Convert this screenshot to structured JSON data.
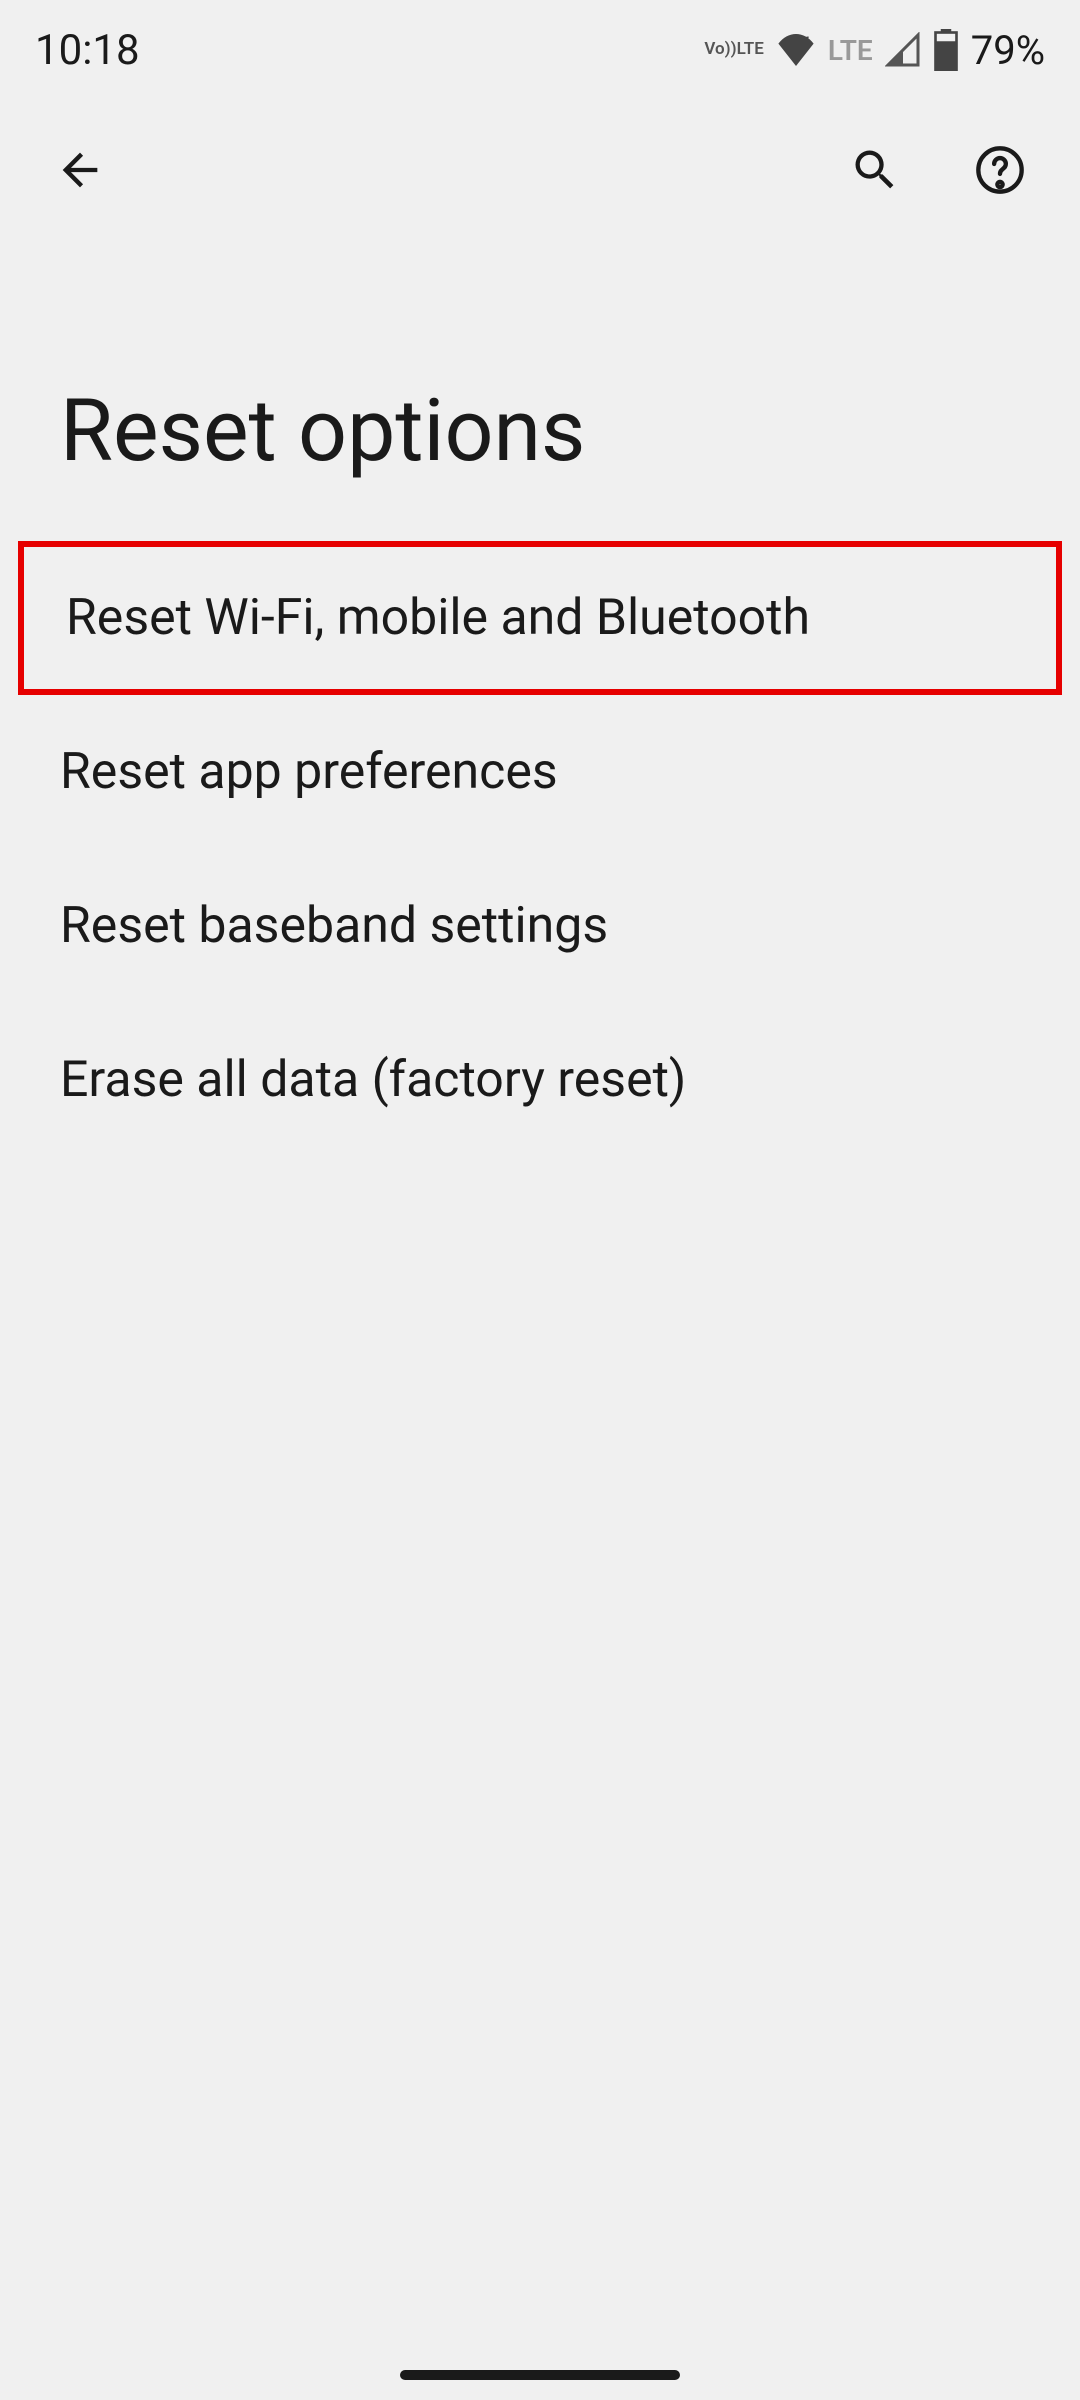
{
  "statusBar": {
    "time": "10:18",
    "volte": "Vo\nLTE",
    "lte": "LTE",
    "batteryPercent": "79%"
  },
  "header": {
    "title": "Reset options"
  },
  "options": [
    {
      "label": "Reset Wi-Fi, mobile and Bluetooth",
      "highlighted": true
    },
    {
      "label": "Reset app preferences",
      "highlighted": false
    },
    {
      "label": "Reset baseband settings",
      "highlighted": false
    },
    {
      "label": "Erase all data (factory reset)",
      "highlighted": false
    }
  ]
}
